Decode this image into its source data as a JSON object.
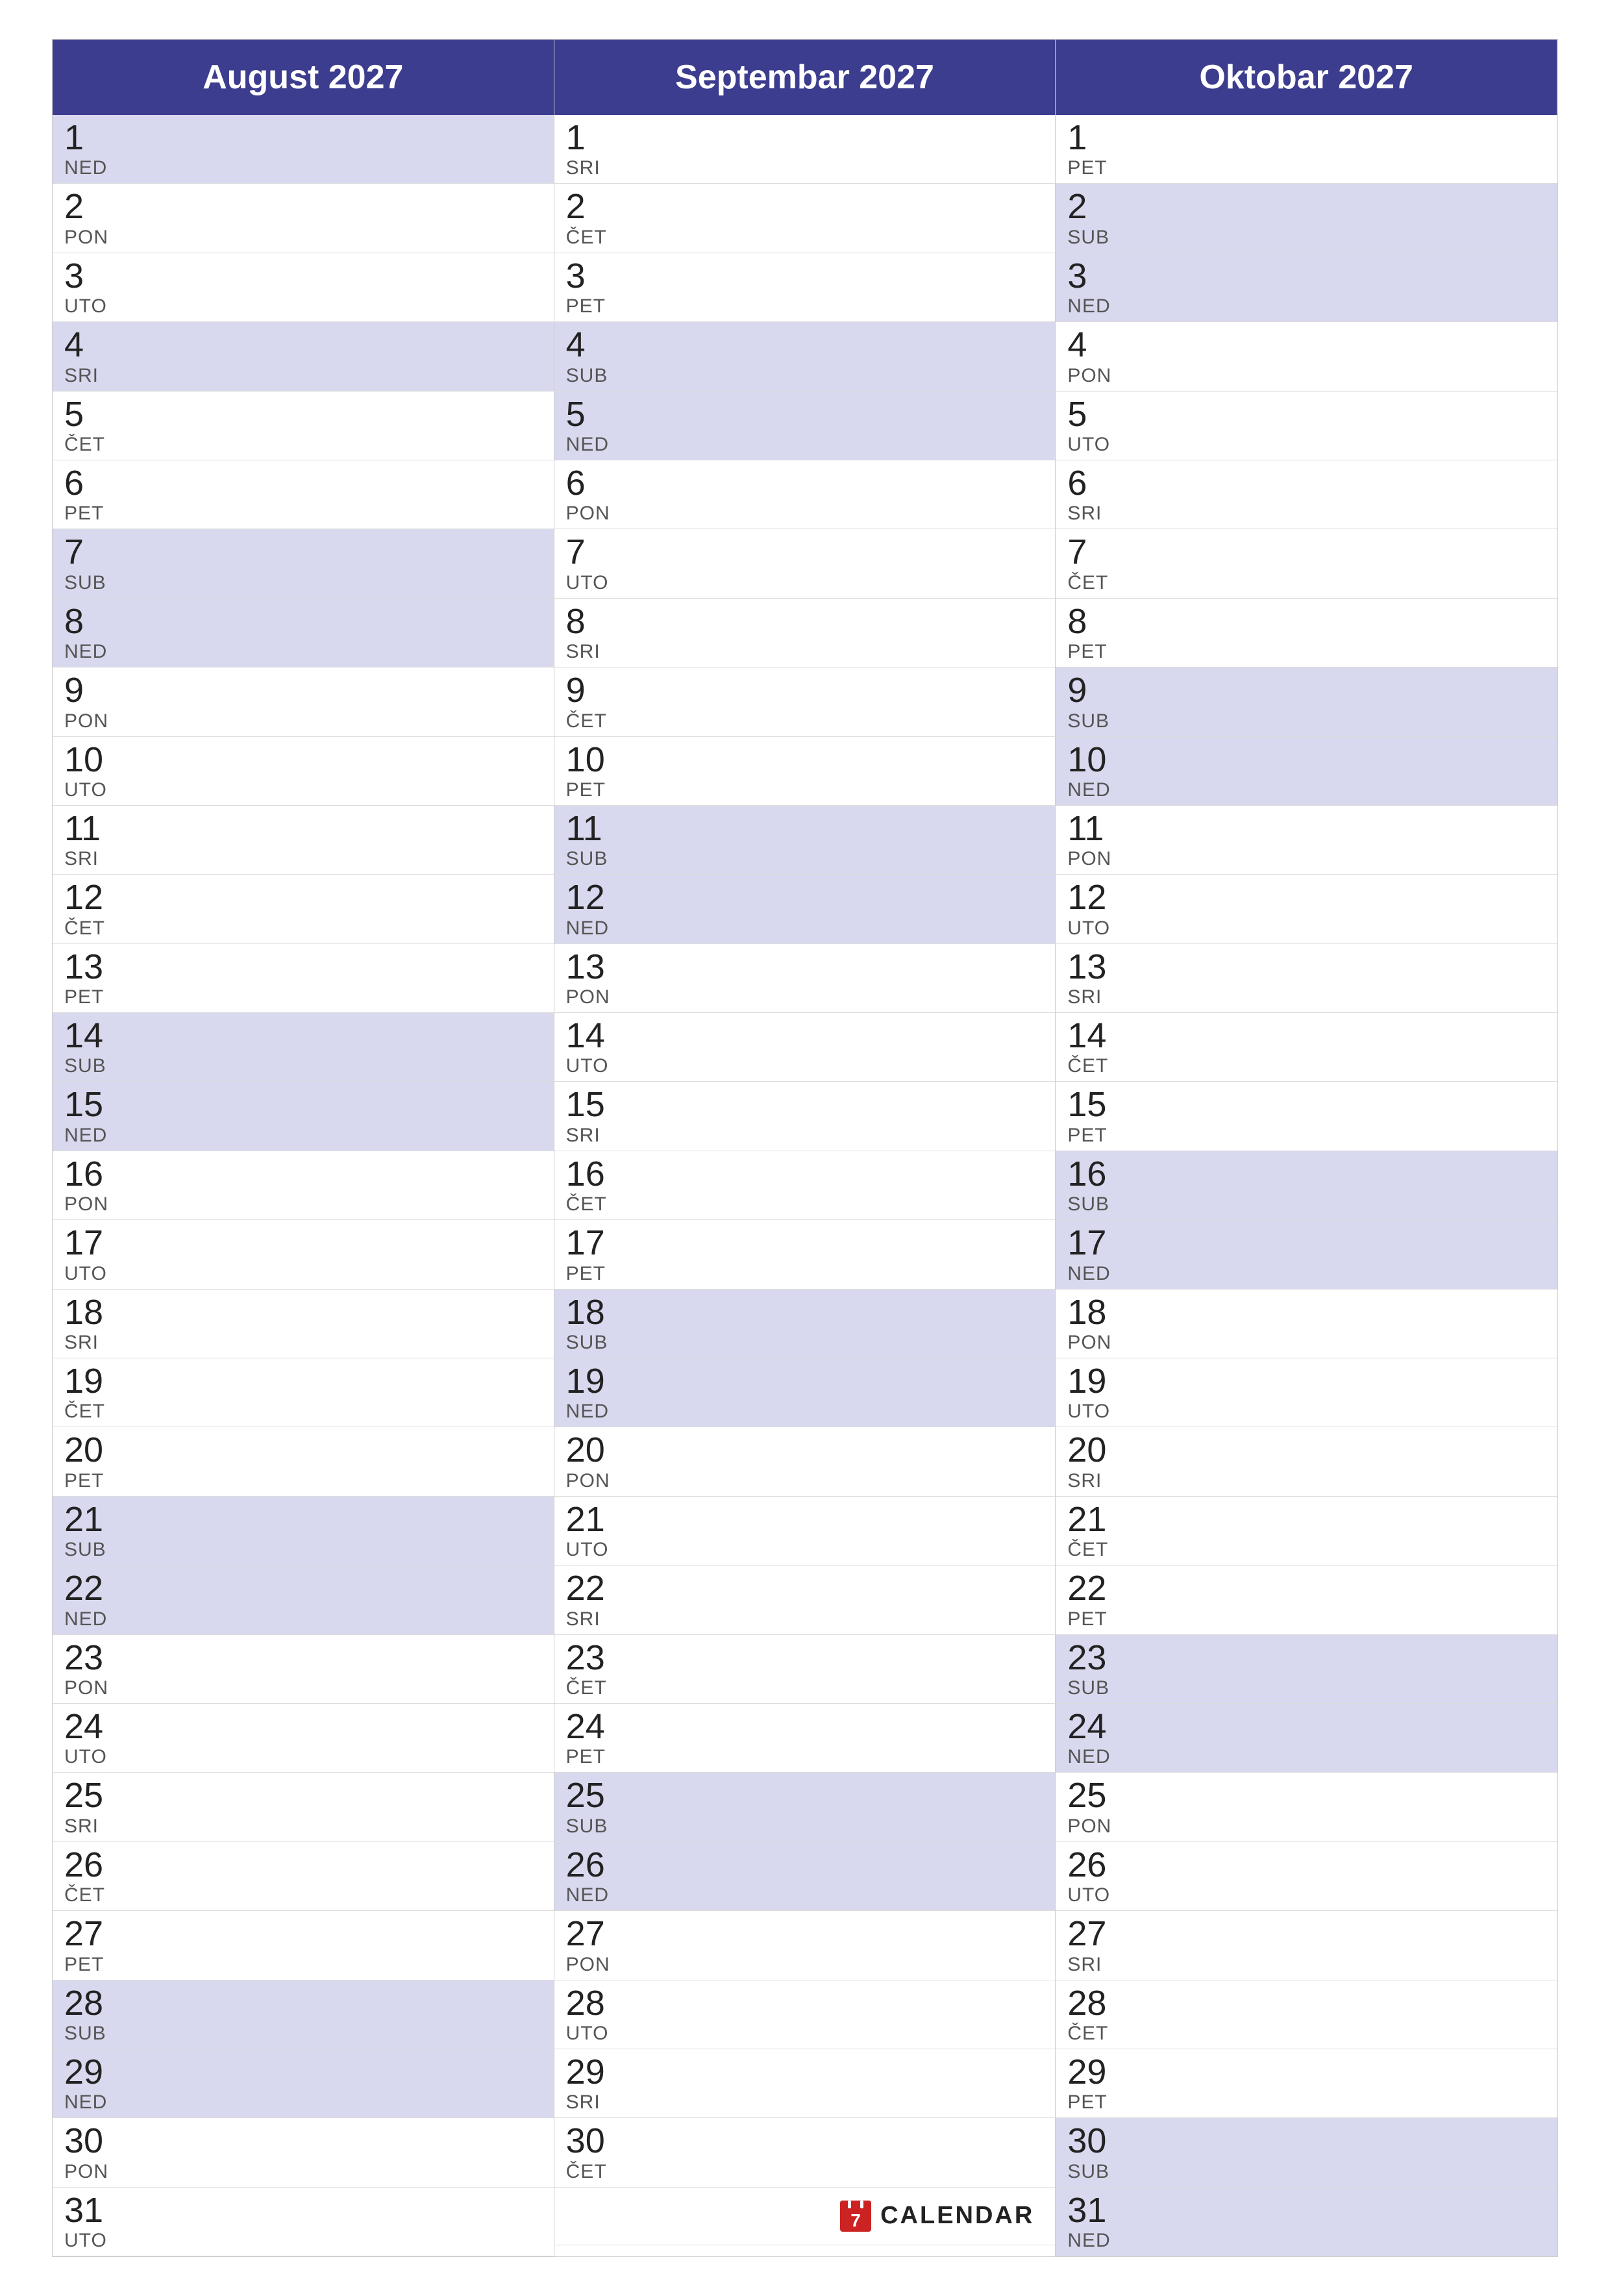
{
  "months": [
    {
      "name": "August 2027",
      "days": [
        {
          "num": "1",
          "name": "NED",
          "highlight": true
        },
        {
          "num": "2",
          "name": "PON",
          "highlight": false
        },
        {
          "num": "3",
          "name": "UTO",
          "highlight": false
        },
        {
          "num": "4",
          "name": "SRI",
          "highlight": true
        },
        {
          "num": "5",
          "name": "ČET",
          "highlight": false
        },
        {
          "num": "6",
          "name": "PET",
          "highlight": false
        },
        {
          "num": "7",
          "name": "SUB",
          "highlight": true
        },
        {
          "num": "8",
          "name": "NED",
          "highlight": true
        },
        {
          "num": "9",
          "name": "PON",
          "highlight": false
        },
        {
          "num": "10",
          "name": "UTO",
          "highlight": false
        },
        {
          "num": "11",
          "name": "SRI",
          "highlight": false
        },
        {
          "num": "12",
          "name": "ČET",
          "highlight": false
        },
        {
          "num": "13",
          "name": "PET",
          "highlight": false
        },
        {
          "num": "14",
          "name": "SUB",
          "highlight": true
        },
        {
          "num": "15",
          "name": "NED",
          "highlight": true
        },
        {
          "num": "16",
          "name": "PON",
          "highlight": false
        },
        {
          "num": "17",
          "name": "UTO",
          "highlight": false
        },
        {
          "num": "18",
          "name": "SRI",
          "highlight": false
        },
        {
          "num": "19",
          "name": "ČET",
          "highlight": false
        },
        {
          "num": "20",
          "name": "PET",
          "highlight": false
        },
        {
          "num": "21",
          "name": "SUB",
          "highlight": true
        },
        {
          "num": "22",
          "name": "NED",
          "highlight": true
        },
        {
          "num": "23",
          "name": "PON",
          "highlight": false
        },
        {
          "num": "24",
          "name": "UTO",
          "highlight": false
        },
        {
          "num": "25",
          "name": "SRI",
          "highlight": false
        },
        {
          "num": "26",
          "name": "ČET",
          "highlight": false
        },
        {
          "num": "27",
          "name": "PET",
          "highlight": false
        },
        {
          "num": "28",
          "name": "SUB",
          "highlight": true
        },
        {
          "num": "29",
          "name": "NED",
          "highlight": true
        },
        {
          "num": "30",
          "name": "PON",
          "highlight": false
        },
        {
          "num": "31",
          "name": "UTO",
          "highlight": false
        }
      ]
    },
    {
      "name": "Septembar 2027",
      "days": [
        {
          "num": "1",
          "name": "SRI",
          "highlight": false
        },
        {
          "num": "2",
          "name": "ČET",
          "highlight": false
        },
        {
          "num": "3",
          "name": "PET",
          "highlight": false
        },
        {
          "num": "4",
          "name": "SUB",
          "highlight": true
        },
        {
          "num": "5",
          "name": "NED",
          "highlight": true
        },
        {
          "num": "6",
          "name": "PON",
          "highlight": false
        },
        {
          "num": "7",
          "name": "UTO",
          "highlight": false
        },
        {
          "num": "8",
          "name": "SRI",
          "highlight": false
        },
        {
          "num": "9",
          "name": "ČET",
          "highlight": false
        },
        {
          "num": "10",
          "name": "PET",
          "highlight": false
        },
        {
          "num": "11",
          "name": "SUB",
          "highlight": true
        },
        {
          "num": "12",
          "name": "NED",
          "highlight": true
        },
        {
          "num": "13",
          "name": "PON",
          "highlight": false
        },
        {
          "num": "14",
          "name": "UTO",
          "highlight": false
        },
        {
          "num": "15",
          "name": "SRI",
          "highlight": false
        },
        {
          "num": "16",
          "name": "ČET",
          "highlight": false
        },
        {
          "num": "17",
          "name": "PET",
          "highlight": false
        },
        {
          "num": "18",
          "name": "SUB",
          "highlight": true
        },
        {
          "num": "19",
          "name": "NED",
          "highlight": true
        },
        {
          "num": "20",
          "name": "PON",
          "highlight": false
        },
        {
          "num": "21",
          "name": "UTO",
          "highlight": false
        },
        {
          "num": "22",
          "name": "SRI",
          "highlight": false
        },
        {
          "num": "23",
          "name": "ČET",
          "highlight": false
        },
        {
          "num": "24",
          "name": "PET",
          "highlight": false
        },
        {
          "num": "25",
          "name": "SUB",
          "highlight": true
        },
        {
          "num": "26",
          "name": "NED",
          "highlight": true
        },
        {
          "num": "27",
          "name": "PON",
          "highlight": false
        },
        {
          "num": "28",
          "name": "UTO",
          "highlight": false
        },
        {
          "num": "29",
          "name": "SRI",
          "highlight": false
        },
        {
          "num": "30",
          "name": "ČET",
          "highlight": false
        }
      ],
      "hasLogo": true
    },
    {
      "name": "Oktobar 2027",
      "days": [
        {
          "num": "1",
          "name": "PET",
          "highlight": false
        },
        {
          "num": "2",
          "name": "SUB",
          "highlight": true
        },
        {
          "num": "3",
          "name": "NED",
          "highlight": true
        },
        {
          "num": "4",
          "name": "PON",
          "highlight": false
        },
        {
          "num": "5",
          "name": "UTO",
          "highlight": false
        },
        {
          "num": "6",
          "name": "SRI",
          "highlight": false
        },
        {
          "num": "7",
          "name": "ČET",
          "highlight": false
        },
        {
          "num": "8",
          "name": "PET",
          "highlight": false
        },
        {
          "num": "9",
          "name": "SUB",
          "highlight": true
        },
        {
          "num": "10",
          "name": "NED",
          "highlight": true
        },
        {
          "num": "11",
          "name": "PON",
          "highlight": false
        },
        {
          "num": "12",
          "name": "UTO",
          "highlight": false
        },
        {
          "num": "13",
          "name": "SRI",
          "highlight": false
        },
        {
          "num": "14",
          "name": "ČET",
          "highlight": false
        },
        {
          "num": "15",
          "name": "PET",
          "highlight": false
        },
        {
          "num": "16",
          "name": "SUB",
          "highlight": true
        },
        {
          "num": "17",
          "name": "NED",
          "highlight": true
        },
        {
          "num": "18",
          "name": "PON",
          "highlight": false
        },
        {
          "num": "19",
          "name": "UTO",
          "highlight": false
        },
        {
          "num": "20",
          "name": "SRI",
          "highlight": false
        },
        {
          "num": "21",
          "name": "ČET",
          "highlight": false
        },
        {
          "num": "22",
          "name": "PET",
          "highlight": false
        },
        {
          "num": "23",
          "name": "SUB",
          "highlight": true
        },
        {
          "num": "24",
          "name": "NED",
          "highlight": true
        },
        {
          "num": "25",
          "name": "PON",
          "highlight": false
        },
        {
          "num": "26",
          "name": "UTO",
          "highlight": false
        },
        {
          "num": "27",
          "name": "SRI",
          "highlight": false
        },
        {
          "num": "28",
          "name": "ČET",
          "highlight": false
        },
        {
          "num": "29",
          "name": "PET",
          "highlight": false
        },
        {
          "num": "30",
          "name": "SUB",
          "highlight": true
        },
        {
          "num": "31",
          "name": "NED",
          "highlight": true
        }
      ]
    }
  ],
  "logo": {
    "label": "CALENDAR"
  }
}
